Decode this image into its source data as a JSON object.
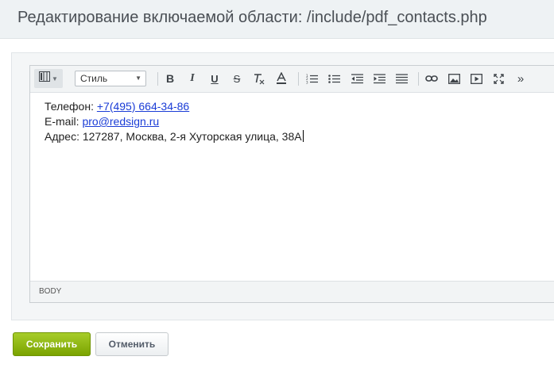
{
  "dialog": {
    "title": "Редактирование включаемой области: /include/pdf_contacts.php"
  },
  "toolbar": {
    "view_icon": "view-mode-icon",
    "style_select_value": "Стиль",
    "icons": [
      "bold-icon",
      "italic-icon",
      "underline-icon",
      "strikethrough-icon",
      "remove-format-icon",
      "text-color-icon",
      "ordered-list-icon",
      "unordered-list-icon",
      "outdent-icon",
      "indent-icon",
      "justify-icon",
      "link-icon",
      "image-icon",
      "video-icon",
      "fullscreen-icon",
      "more-icon"
    ],
    "bold_label": "B",
    "italic_label": "I",
    "underline_label": "U",
    "strike_label": "S",
    "more_label": "»"
  },
  "content": {
    "phone_label": "Телефон: ",
    "phone_value": "+7(495) 664-34-86",
    "email_label": "E-mail: ",
    "email_value": "pro@redsign.ru",
    "address": "Адрес: 127287, Москва, 2-я Хуторская улица, 38А"
  },
  "status_bar": {
    "path": "BODY"
  },
  "buttons": {
    "save_label": "Сохранить",
    "cancel_label": "Отменить"
  },
  "colors": {
    "save_button": "#86ad00",
    "link": "#1a3cd6"
  }
}
